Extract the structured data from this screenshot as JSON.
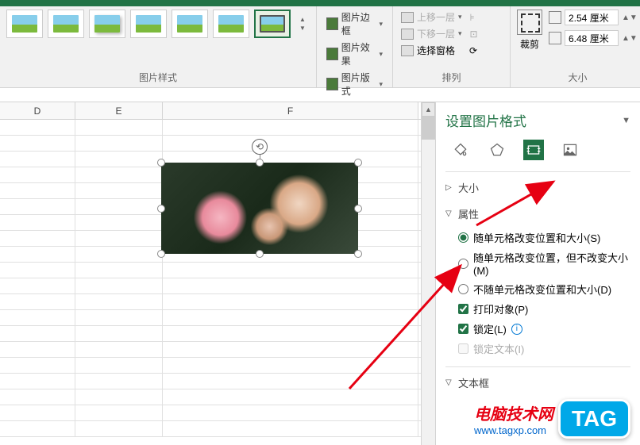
{
  "ribbon": {
    "groups": {
      "styles": {
        "label": "图片样式"
      },
      "adjust": {
        "border": "图片边框",
        "effect": "图片效果",
        "layout": "图片版式"
      },
      "arrange": {
        "label": "排列",
        "bring_forward": "上移一层",
        "send_backward": "下移一层",
        "selection_pane": "选择窗格"
      },
      "size": {
        "label": "大小",
        "crop": "裁剪",
        "height": "2.54 厘米",
        "width": "6.48 厘米"
      }
    }
  },
  "columns": {
    "D": "D",
    "E": "E",
    "F": "F"
  },
  "pane": {
    "title": "设置图片格式",
    "sections": {
      "size": "大小",
      "properties": "属性",
      "textbox": "文本框"
    },
    "props": {
      "opt1": "随单元格改变位置和大小(S)",
      "opt2": "随单元格改变位置，但不改变大小(M)",
      "opt3": "不随单元格改变位置和大小(D)",
      "print": "打印对象(P)",
      "lock": "锁定(L)",
      "locktext": "锁定文本(I)"
    }
  },
  "watermark": {
    "line1": "电脑技术网",
    "line2": "www.tagxp.com",
    "tag": "TAG"
  }
}
